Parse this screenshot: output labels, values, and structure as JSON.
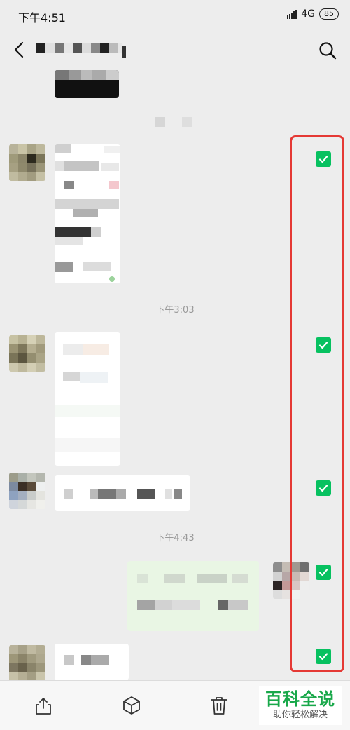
{
  "status_bar": {
    "time": "下午4:51",
    "network": "4G",
    "battery": "85"
  },
  "nav": {
    "back_icon": "chevron-left-icon",
    "search_icon": "search-icon"
  },
  "chat": {
    "timestamps": [
      "下午3:03",
      "下午4:43"
    ],
    "selected_count": 5
  },
  "colors": {
    "accent": "#07c160",
    "highlight": "#e53935",
    "background": "#ededed"
  },
  "toolbar": {
    "items": [
      "share-icon",
      "box-icon",
      "trash-icon"
    ]
  },
  "watermark": {
    "title": "百科全说",
    "subtitle": "助你轻松解决"
  }
}
